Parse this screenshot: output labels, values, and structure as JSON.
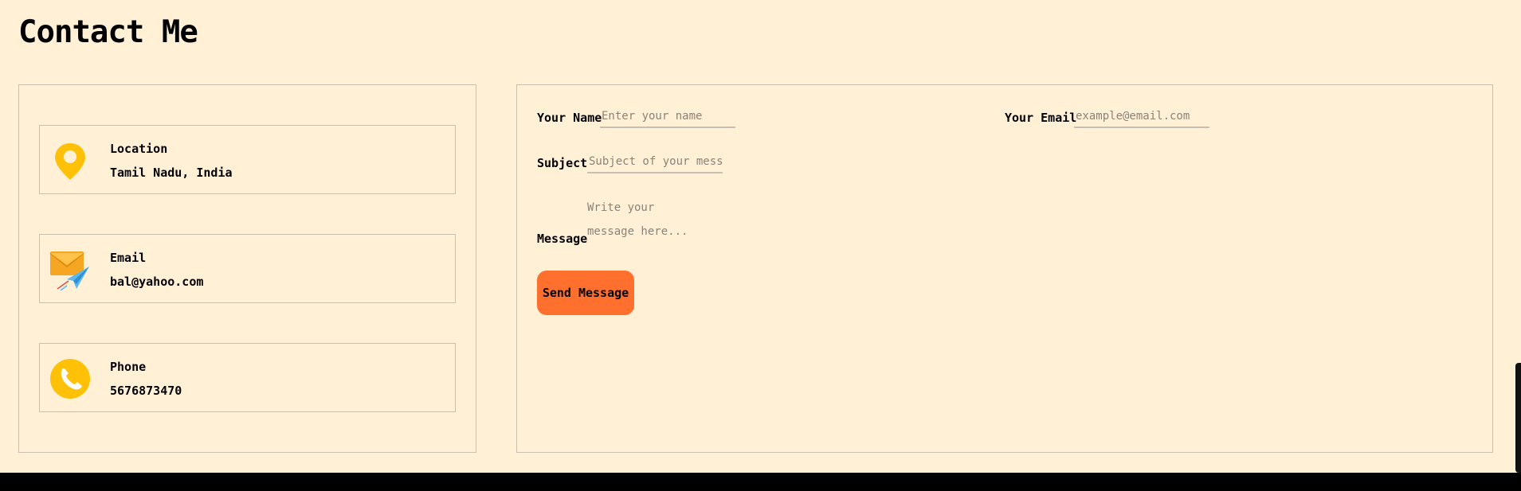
{
  "page": {
    "title": "Contact Me"
  },
  "info": {
    "location": {
      "label": "Location",
      "value": "Tamil Nadu, India",
      "icon": "location-pin-icon"
    },
    "email": {
      "label": "Email",
      "value": "bal@yahoo.com",
      "icon": "envelope-icon"
    },
    "phone": {
      "label": "Phone",
      "value": "5676873470",
      "icon": "phone-icon"
    }
  },
  "form": {
    "name_label": "Your Name",
    "name_placeholder": "Enter your name",
    "email_label": "Your Email",
    "email_placeholder": "example@email.com",
    "subject_label": "Subject",
    "subject_placeholder": "Subject of your message",
    "message_label": "Message",
    "message_placeholder": "Write your message here...",
    "submit_label": "Send Message"
  },
  "colors": {
    "background": "#fff0d6",
    "accent": "#ff6f2d",
    "icon_yellow": "#ffc107"
  }
}
